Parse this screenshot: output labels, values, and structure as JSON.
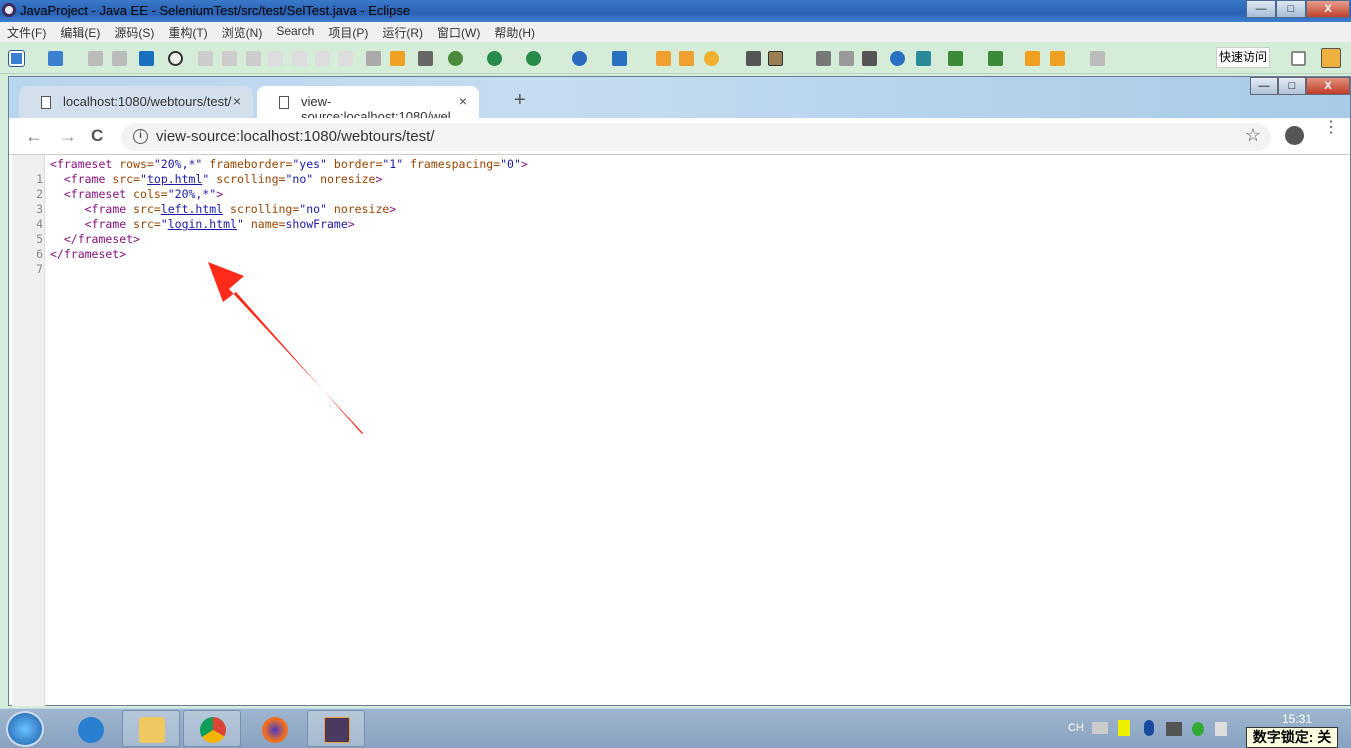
{
  "window": {
    "title": "JavaProject  -  Java EE  -  SeleniumTest/src/test/SelTest.java  -  Eclipse",
    "minimize": "—",
    "maximize": "□",
    "close": "X"
  },
  "menu": [
    "文件(F)",
    "编辑(E)",
    "源码(S)",
    "重构(T)",
    "浏览(N)",
    "Search",
    "项目(P)",
    "运行(R)",
    "窗口(W)",
    "帮助(H)"
  ],
  "toolbar": {
    "quick_access": "快速访问"
  },
  "browser": {
    "tabs": [
      {
        "label": "localhost:1080/webtours/test/",
        "close": "×"
      },
      {
        "label": "view-source:localhost:1080/wel",
        "close": "×"
      }
    ],
    "new_tab": "+",
    "back": "←",
    "forward": "→",
    "reload": "C",
    "info": "i",
    "url": "view-source:localhost:1080/webtours/test/",
    "bookmark": "☆",
    "menu": "⋮",
    "controls": {
      "minimize": "—",
      "maximize": "□",
      "close": "X"
    }
  },
  "source": {
    "line_numbers": [
      "1",
      "2",
      "3",
      "4",
      "5",
      "6",
      "7"
    ],
    "l1": {
      "open": "<frameset ",
      "a1": "rows=",
      "v1": "\"20%,*\"",
      "a2": " frameborder=",
      "v2": "\"yes\"",
      "a3": " border=",
      "v3": "\"1\"",
      "a4": " framespacing=",
      "v4": "\"0\"",
      "close": ">"
    },
    "l2": {
      "indent": "  ",
      "open": "<frame ",
      "a1": "src=",
      "q1": "\"",
      "link": "top.html",
      "q2": "\"",
      "a2": " scrolling=",
      "v2": "\"no\"",
      "a3": " noresize",
      "close": ">"
    },
    "l3": {
      "indent": "  ",
      "open": "<frameset ",
      "a1": "cols=",
      "v1": "\"20%,*\"",
      "close": ">"
    },
    "l4": {
      "indent": "     ",
      "open": "<frame ",
      "a1": "src=",
      "link": "left.html",
      "a2": " scrolling=",
      "v2": "\"no\"",
      "a3": " noresize",
      "close": ">"
    },
    "l5": {
      "indent": "     ",
      "open": "<frame ",
      "a1": "src=",
      "q1": "\"",
      "link": "login.html",
      "q2": "\"",
      "a2": " name=",
      "v2": "showFrame",
      "close": ">"
    },
    "l6": {
      "indent": "  ",
      "tag": "</frameset>"
    },
    "l7": {
      "tag": "</frameset>"
    }
  },
  "taskbar": {
    "ime": "CH",
    "clock": "15:31",
    "numlock": "数字锁定: 关",
    "apps": [
      "internet-explorer",
      "file-explorer",
      "chrome",
      "firefox",
      "eclipse-java-ee"
    ]
  },
  "colors": {
    "tag": "#881280",
    "attr": "#994500",
    "value": "#1a1aa6",
    "arrow": "#ff2a1a"
  }
}
